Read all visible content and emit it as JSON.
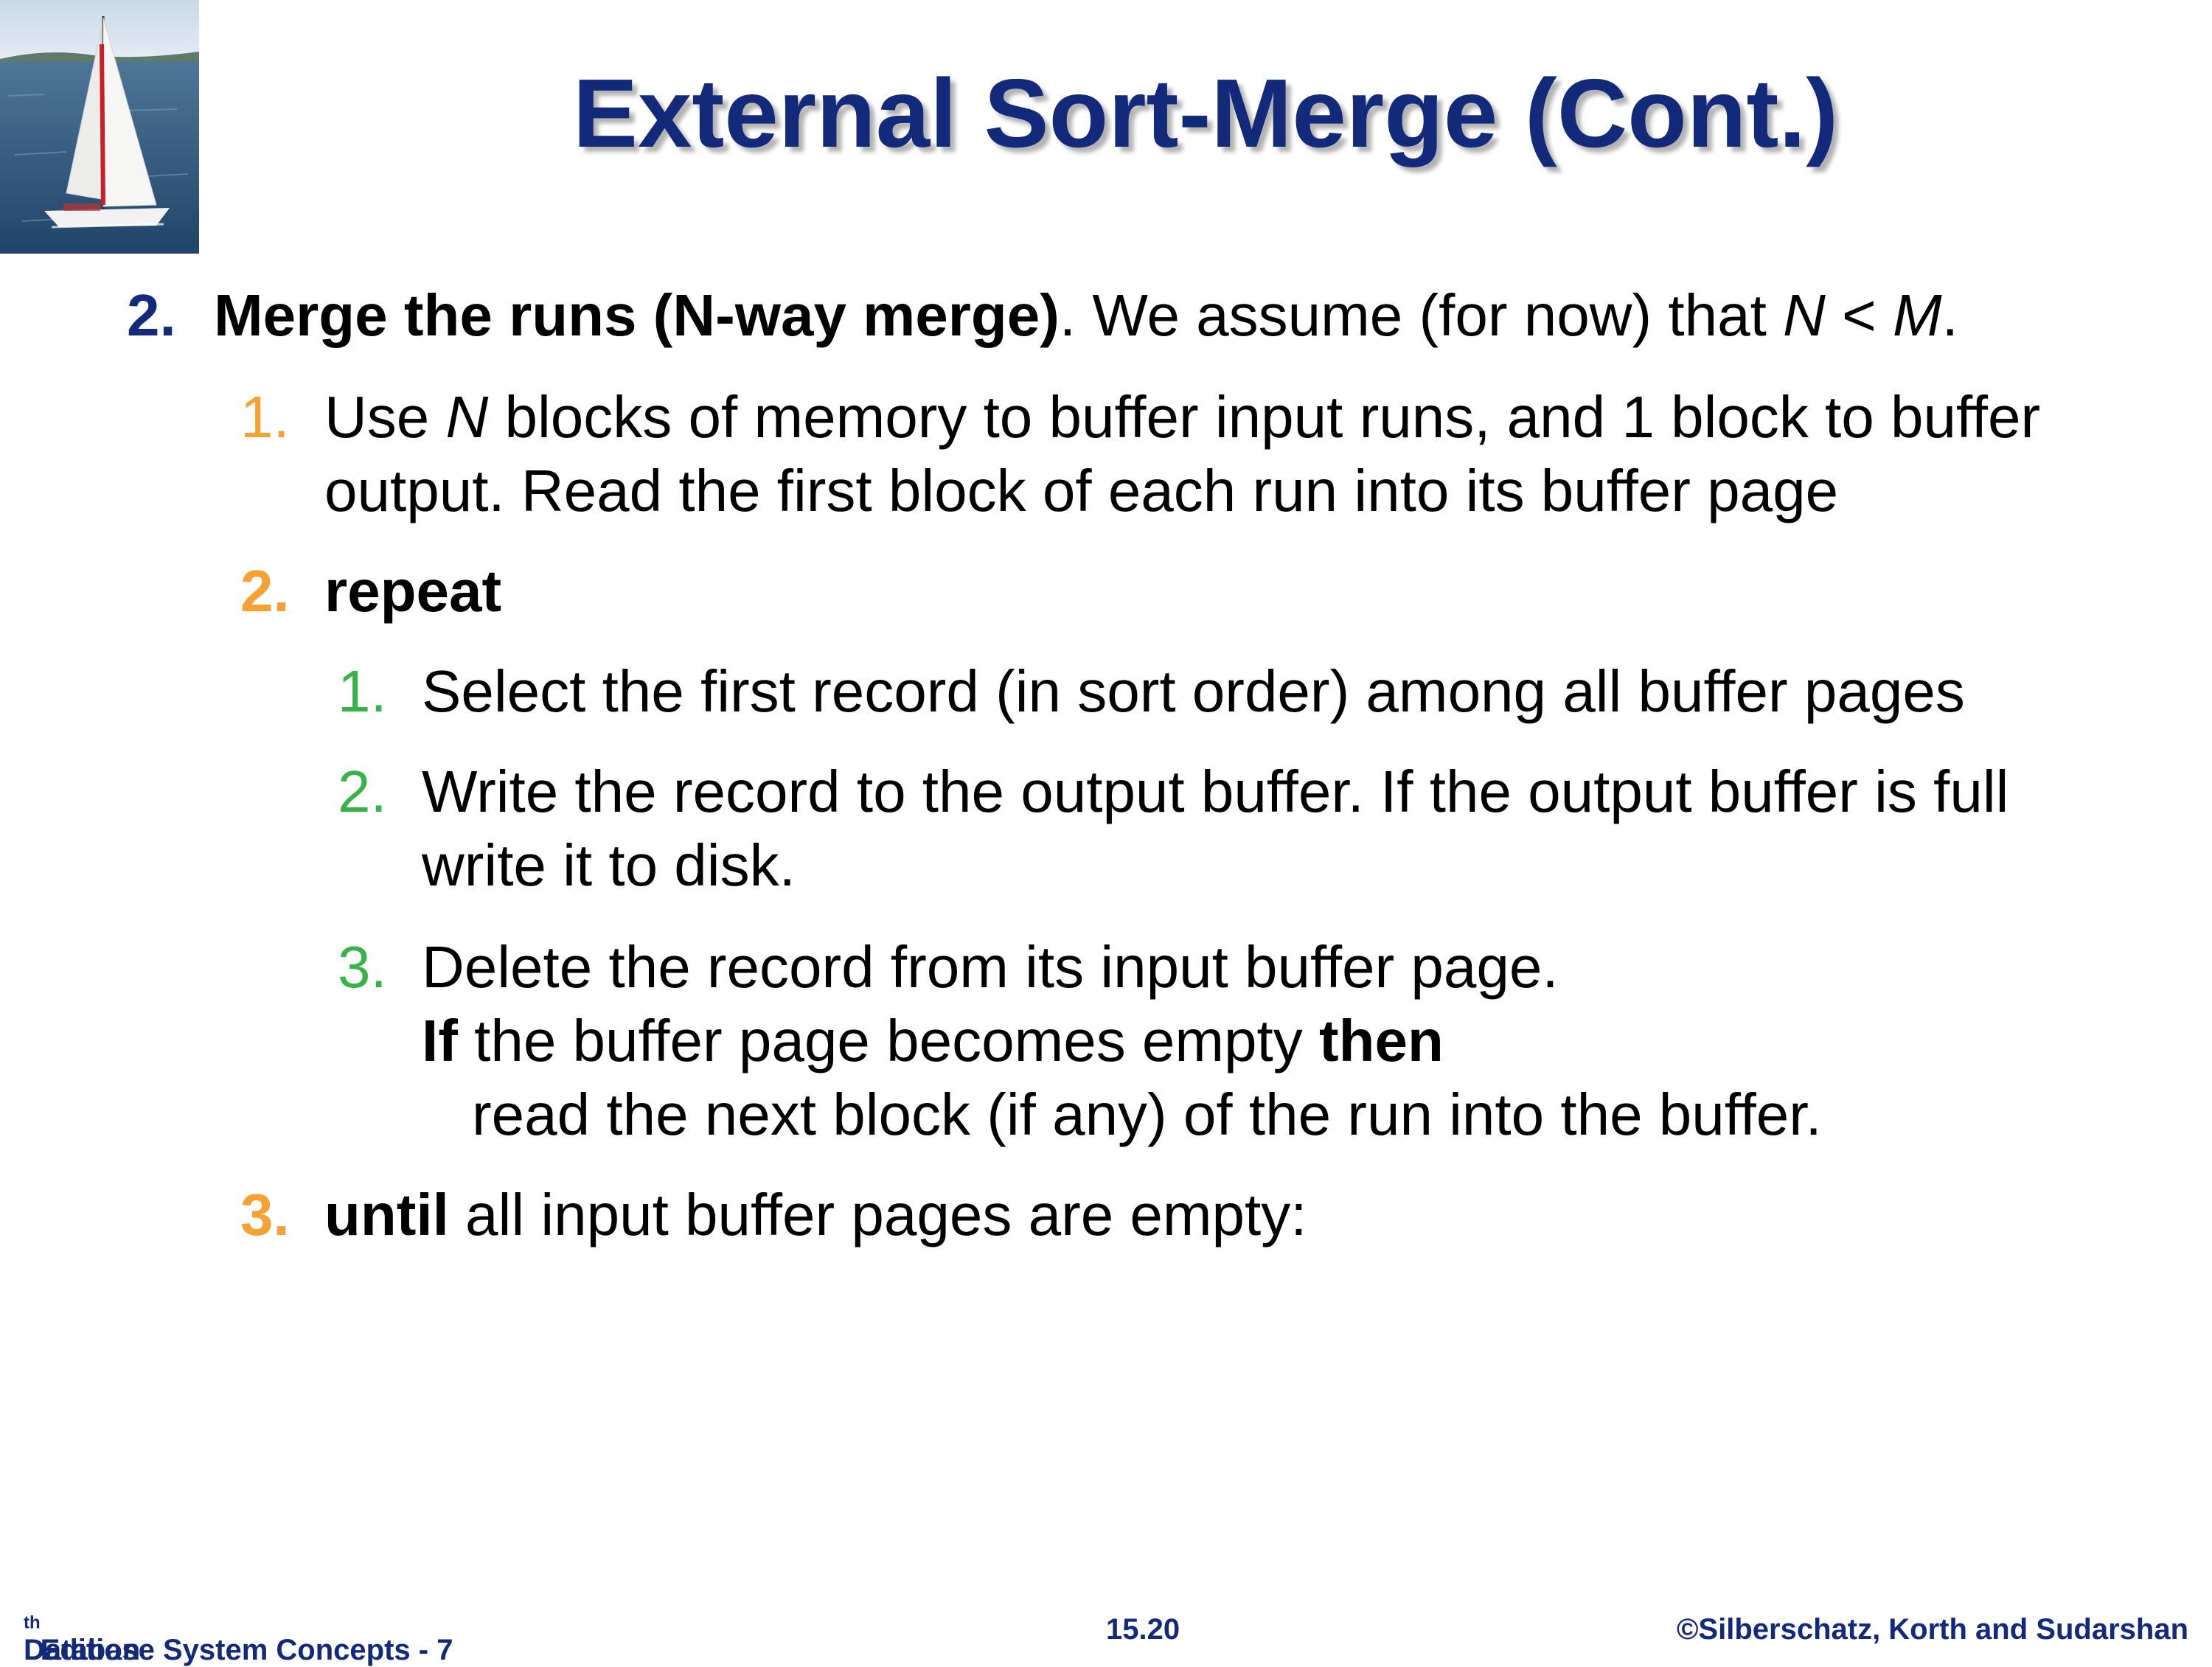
{
  "slide": {
    "title": "External Sort-Merge (Cont.)",
    "logo_icon": "sailboat-image",
    "colors": {
      "title": "#13297a",
      "level1_number": "#13297a",
      "level2_number": "#f7a134",
      "level3_number": "#37b34a"
    }
  },
  "body": {
    "step2": {
      "number": "2.",
      "bold_text": "Merge the runs (N-way merge)",
      "text_a": ". We assume (for now) that ",
      "var_n": "N",
      "text_b": " < ",
      "var_m": "M",
      "text_c": "."
    },
    "sub1": {
      "number": "1.",
      "text_a": "Use ",
      "var_n": "N",
      "text_b": " blocks of memory to buffer input runs, and 1 block to buffer",
      "line2": "output. Read the first block of each run into its buffer page"
    },
    "sub2": {
      "number": "2.",
      "bold_text": "repeat"
    },
    "inner1": {
      "number": "1.",
      "text": "Select the first record (in sort order) among all buffer pages"
    },
    "inner2": {
      "number": "2.",
      "line1": "Write the record to the output buffer.  If the output buffer is full",
      "line2": "write it to disk."
    },
    "inner3": {
      "number": "3.",
      "line1": "Delete the record from its input buffer page.",
      "if_kw": "If",
      "line2_mid": " the buffer page becomes empty ",
      "then_kw": "then",
      "line3": "read the next block (if any) of the run into the buffer."
    },
    "sub3": {
      "number": "3.",
      "until_kw": "until",
      "text": " all input buffer pages are empty:"
    }
  },
  "footer": {
    "left_a": "Database System Concepts - 7",
    "left_sup": "th",
    "left_b": " Edition",
    "center": "15.20",
    "right": "©Silberschatz, Korth and Sudarshan"
  }
}
